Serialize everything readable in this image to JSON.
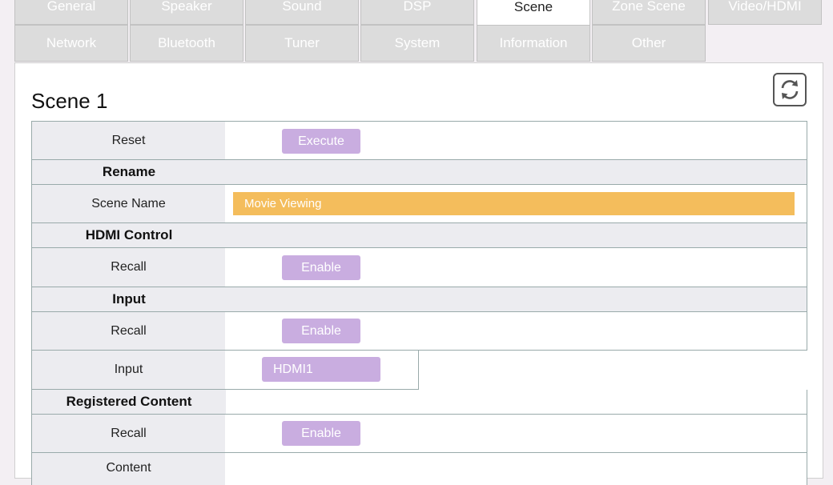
{
  "tabs": {
    "row1": [
      "General",
      "Speaker",
      "Sound",
      "DSP",
      "Scene",
      "Zone Scene",
      "Video/HDMI"
    ],
    "row2": [
      "Network",
      "Bluetooth",
      "Tuner",
      "System",
      "Information",
      "Other"
    ],
    "active": "Scene"
  },
  "scene": {
    "title": "Scene 1",
    "reset_label": "Reset",
    "reset_button": "Execute",
    "rename_header": "Rename",
    "scene_name_label": "Scene Name",
    "scene_name_value": "Movie Viewing",
    "hdmi_header": "HDMI Control",
    "hdmi_recall_label": "Recall",
    "hdmi_recall_button": "Enable",
    "input_header": "Input",
    "input_recall_label": "Recall",
    "input_recall_button": "Enable",
    "input_label": "Input",
    "input_value": "HDMI1",
    "registered_header": "Registered Content",
    "registered_recall_label": "Recall",
    "registered_recall_button": "Enable",
    "content_label": "Content"
  },
  "colors": {
    "accent_button": "#c9ade0",
    "name_field": "#f4bd5c",
    "label_bg": "#ececf0"
  }
}
